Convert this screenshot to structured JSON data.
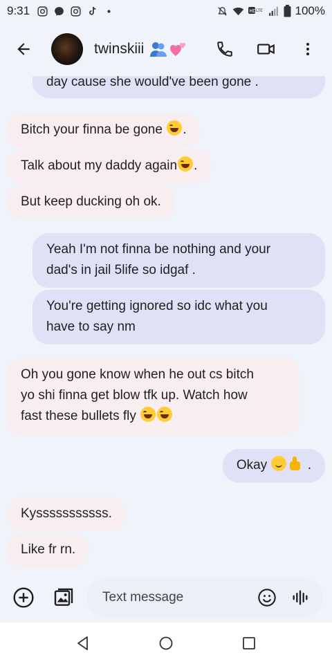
{
  "status_bar": {
    "time": "9:31",
    "battery": "100%",
    "left_icons": [
      "instagram-icon",
      "messenger-icon",
      "instagram-icon",
      "tiktok-icon",
      "dot-icon"
    ],
    "right_icons": [
      "mute-icon",
      "wifi-icon",
      "hd-lte-icon",
      "signal-icon",
      "battery-icon"
    ]
  },
  "header": {
    "contact_name": "twinskiii",
    "name_emojis": [
      "people-hugging-icon",
      "two-hearts-icon"
    ],
    "actions": [
      "phone-icon",
      "video-call-icon",
      "more-vert-icon"
    ]
  },
  "messages": [
    {
      "dir": "out",
      "text": "day cause she would've been gone ."
    },
    {
      "dir": "in",
      "text": "Bitch your finna be gone ",
      "emoji": [
        "laugh"
      ],
      "tail": "."
    },
    {
      "dir": "in",
      "text": "Talk about my daddy again",
      "emoji": [
        "laugh"
      ],
      "tail": "."
    },
    {
      "dir": "in",
      "text": "But keep ducking oh ok."
    },
    {
      "dir": "out",
      "lines": [
        "Yeah I'm not finna be nothing and your",
        "dad's in jail 5life so idgaf ."
      ]
    },
    {
      "dir": "out",
      "lines": [
        "You're getting ignored so idc what you",
        "have to say nm"
      ]
    },
    {
      "dir": "in",
      "lines": [
        "Oh you gone know when he out cs bitch",
        "yo shi finna get blow tfk up. Watch how",
        "fast these bullets fly "
      ],
      "emoji": [
        "laugh",
        "laugh"
      ]
    },
    {
      "dir": "out",
      "text": "Okay ",
      "emoji": [
        "smile",
        "thumb"
      ],
      "tail": " ."
    },
    {
      "dir": "in",
      "text": "Kysssssssssss."
    },
    {
      "dir": "in",
      "text": "Like fr rn."
    }
  ],
  "composer": {
    "placeholder": "Text message",
    "left_icons": [
      "add-circle-icon",
      "gallery-icon"
    ],
    "right_icons": [
      "emoji-icon",
      "voice-icon"
    ]
  },
  "nav": [
    "back-triangle-icon",
    "home-circle-icon",
    "recents-square-icon"
  ],
  "colors": {
    "background": "#f1f3fb",
    "incoming_bubble": "#f8eef0",
    "outgoing_bubble": "#dfe1f7"
  }
}
